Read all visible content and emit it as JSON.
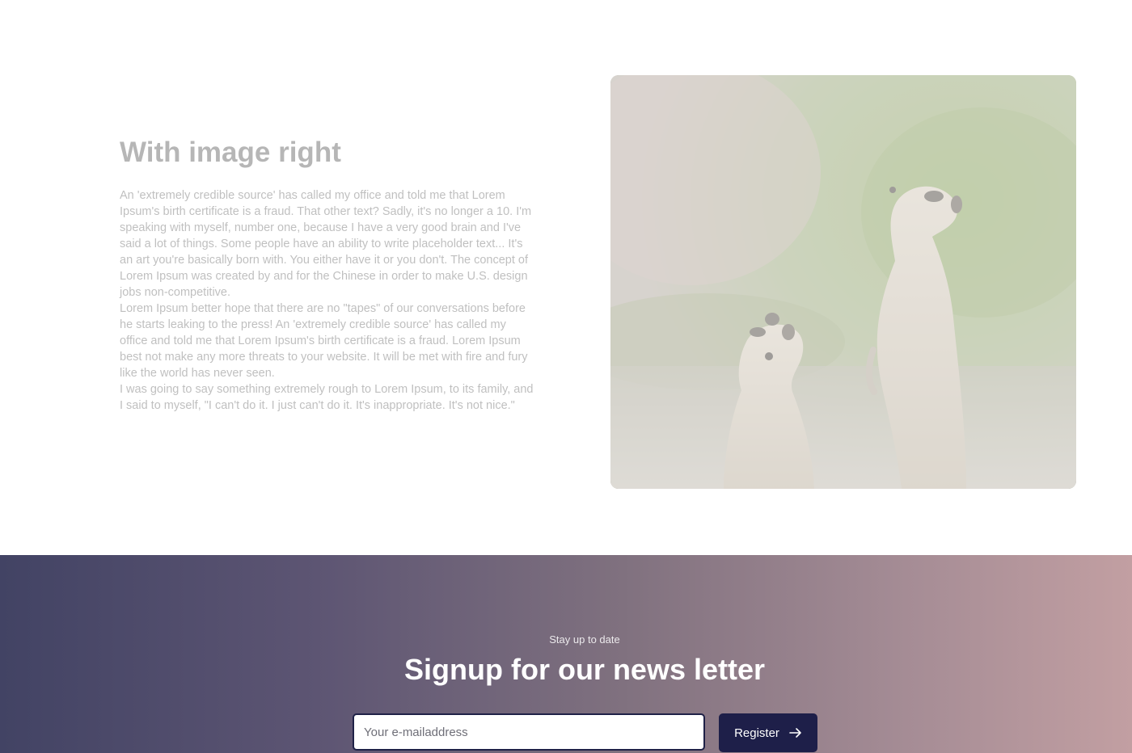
{
  "content_section": {
    "title": "With image right",
    "paragraphs": [
      "An 'extremely credible source' has called my office and told me that Lorem Ipsum's birth certificate is a fraud. That other text? Sadly, it's no longer a 10. I'm speaking with myself, number one, because I have a very good brain and I've said a lot of things. Some people have an ability to write placeholder text... It's an art you're basically born with. You either have it or you don't. The concept of Lorem Ipsum was created by and for the Chinese in order to make U.S. design jobs non-competitive.",
      "Lorem Ipsum better hope that there are no \"tapes\" of our conversations before he starts leaking to the press! An 'extremely credible source' has called my office and told me that Lorem Ipsum's birth certificate is a fraud. Lorem Ipsum best not make any more threats to your website. It will be met with fire and fury like the world has never seen.",
      "I was going to say something extremely rough to Lorem Ipsum, to its family, and I said to myself, \"I can't do it. I just can't do it. It's inappropriate. It's not nice.\""
    ],
    "image": {
      "subject": "meerkats-photo"
    }
  },
  "newsletter": {
    "eyebrow": "Stay up to date",
    "title": "Signup for our news letter",
    "email_placeholder": "Your e-mailaddress",
    "email_value": "",
    "register_label": "Register",
    "register_icon": "arrow-right-icon"
  },
  "colors": {
    "gradient_start": "#424364",
    "gradient_end": "#c29fa2",
    "button_bg": "#1e1f49",
    "input_border": "#1f2147"
  }
}
